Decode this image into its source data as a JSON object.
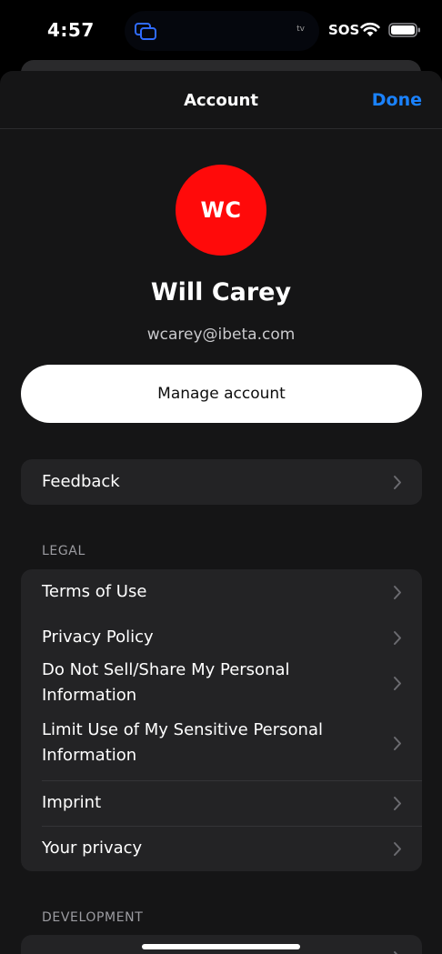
{
  "status_bar": {
    "time": "4:57",
    "island_label": "tv",
    "sos": "SOS",
    "icons": [
      "stacked-windows-icon",
      "wifi-icon",
      "battery-icon"
    ]
  },
  "nav": {
    "title": "Account",
    "done_label": "Done"
  },
  "profile": {
    "initials": "WC",
    "name": "Will Carey",
    "email": "wcarey@ibeta.com",
    "avatar_color": "#ff0a0a"
  },
  "manage_account_label": "Manage account",
  "feedback": {
    "label": "Feedback"
  },
  "legal": {
    "header": "LEGAL",
    "items": [
      {
        "label": "Terms of Use"
      },
      {
        "label": "Privacy Policy"
      },
      {
        "label": "Do Not Sell/Share My Personal Information"
      },
      {
        "label": "Limit Use of My Sensitive Personal Information"
      },
      {
        "label": "Imprint"
      },
      {
        "label": "Your privacy"
      }
    ]
  },
  "development": {
    "header": "DEVELOPMENT"
  },
  "colors": {
    "accent": "#1a82ff",
    "background": "#000000",
    "sheet": "#151516",
    "group": "#232325"
  }
}
